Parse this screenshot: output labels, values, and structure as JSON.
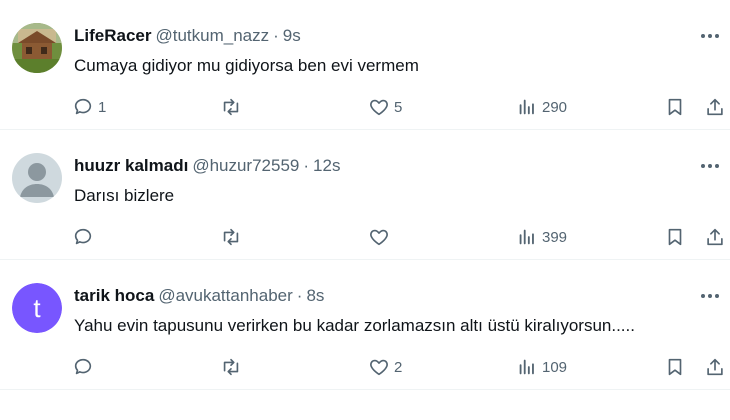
{
  "tweets": [
    {
      "name": "LifeRacer",
      "handle": "@tutkum_nazz",
      "separator": "·",
      "time": "9s",
      "text": "Cumaya gidiyor mu gidiyorsa ben evi vermem",
      "avatar": "photo-house-avatar",
      "replies": "1",
      "retweets": "",
      "likes": "5",
      "views": "290"
    },
    {
      "name": "huuzr kalmadı",
      "handle": "@huzur72559",
      "separator": "·",
      "time": "12s",
      "text": "Darısı bizlere",
      "avatar": "default-person-avatar",
      "replies": "",
      "retweets": "",
      "likes": "",
      "views": "399"
    },
    {
      "name": "tarik hoca",
      "handle": "@avukattanhaber",
      "separator": "·",
      "time": "8s",
      "avatar_letter": "t",
      "text": "Yahu evin tapusunu verirken bu kadar zorlamazsın altı üstü kiralıyorsun.....",
      "avatar_color": "#7856ff",
      "replies": "",
      "retweets": "",
      "likes": "2",
      "views": "109"
    }
  ],
  "colors": {
    "text": "#0f1419",
    "secondary": "#536471",
    "divider": "#eff3f4"
  }
}
